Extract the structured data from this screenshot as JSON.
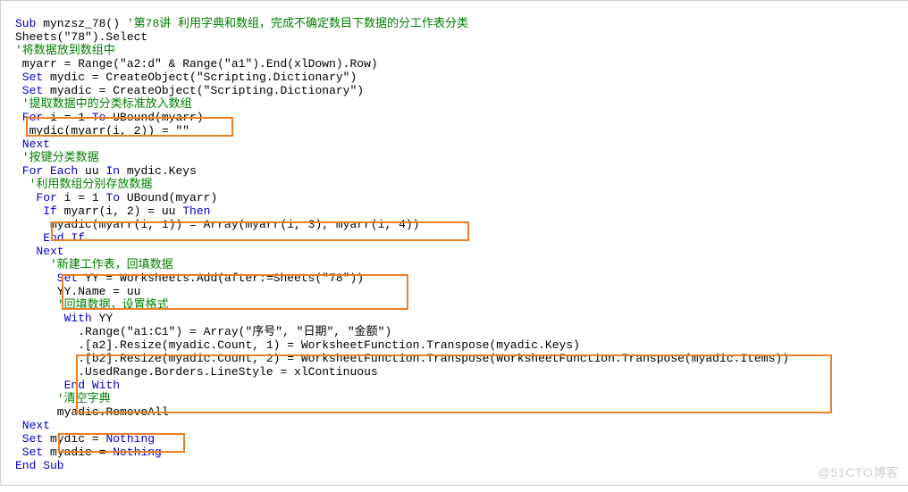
{
  "watermark": "@51CTO博客",
  "code": {
    "l1a": "Sub",
    "l1b": " mynzsz_78() ",
    "l1c": "'第78讲 利用字典和数组，完成不确定数目下数据的分工作表分类",
    "l2": "Sheets(\"78\").Select",
    "l3": "'将数据放到数组中",
    "l4": " myarr = Range(\"a2:d\" & Range(\"a1\").End(xlDown).Row)",
    "l5a": " Set",
    "l5b": " mydic = CreateObject(\"Scripting.Dictionary\")",
    "l6a": " Set",
    "l6b": " myadic = CreateObject(\"Scripting.Dictionary\")",
    "l7": " '提取数据中的分类标准放入数组",
    "l8a": " For",
    "l8b": " i = 1 ",
    "l8c": "To",
    "l8d": " UBound(myarr)",
    "l9": "  mydic(myarr(i, 2)) = \"\"",
    "l10": " Next",
    "l11": " '按键分类数据",
    "l12a": " For Each",
    "l12b": " uu ",
    "l12c": "In",
    "l12d": " mydic.Keys",
    "l13": "  '利用数组分别存放数据",
    "l14a": "   For",
    "l14b": " i = 1 ",
    "l14c": "To",
    "l14d": " UBound(myarr)",
    "l15a": "    If",
    "l15b": " myarr(i, 2) = uu ",
    "l15c": "Then",
    "l16": "     myadic(myarr(i, 1)) = Array(myarr(i, 3), myarr(i, 4))",
    "l17": "    End If",
    "l18": "   Next",
    "l19": "     '新建工作表，回填数据",
    "l20a": "      Set",
    "l20b": " YY = Worksheets.Add(after:=Sheets(\"78\"))",
    "l21": "      YY.Name = uu",
    "l22": "      '回填数据，设置格式",
    "l23a": "       With",
    "l23b": " YY",
    "l24": "         .Range(\"a1:C1\") = Array(\"序号\", \"日期\", \"金额\")",
    "l25": "         .[a2].Resize(myadic.Count, 1) = WorksheetFunction.Transpose(myadic.Keys)",
    "l26": "         .[b2].Resize(myadic.Count, 2) = WorksheetFunction.Transpose(WorksheetFunction.Transpose(myadic.Items))",
    "l27": "         .UsedRange.Borders.LineStyle = xlContinuous",
    "l28": "       End With",
    "l29": "      '清空字典",
    "l30": "      myadic.RemoveAll",
    "l31": " Next",
    "l32a": " Set",
    "l32b": " mydic = ",
    "l32c": "Nothing",
    "l33a": " Set",
    "l33b": " myadic = ",
    "l33c": "Nothing",
    "l34": "End Sub"
  }
}
